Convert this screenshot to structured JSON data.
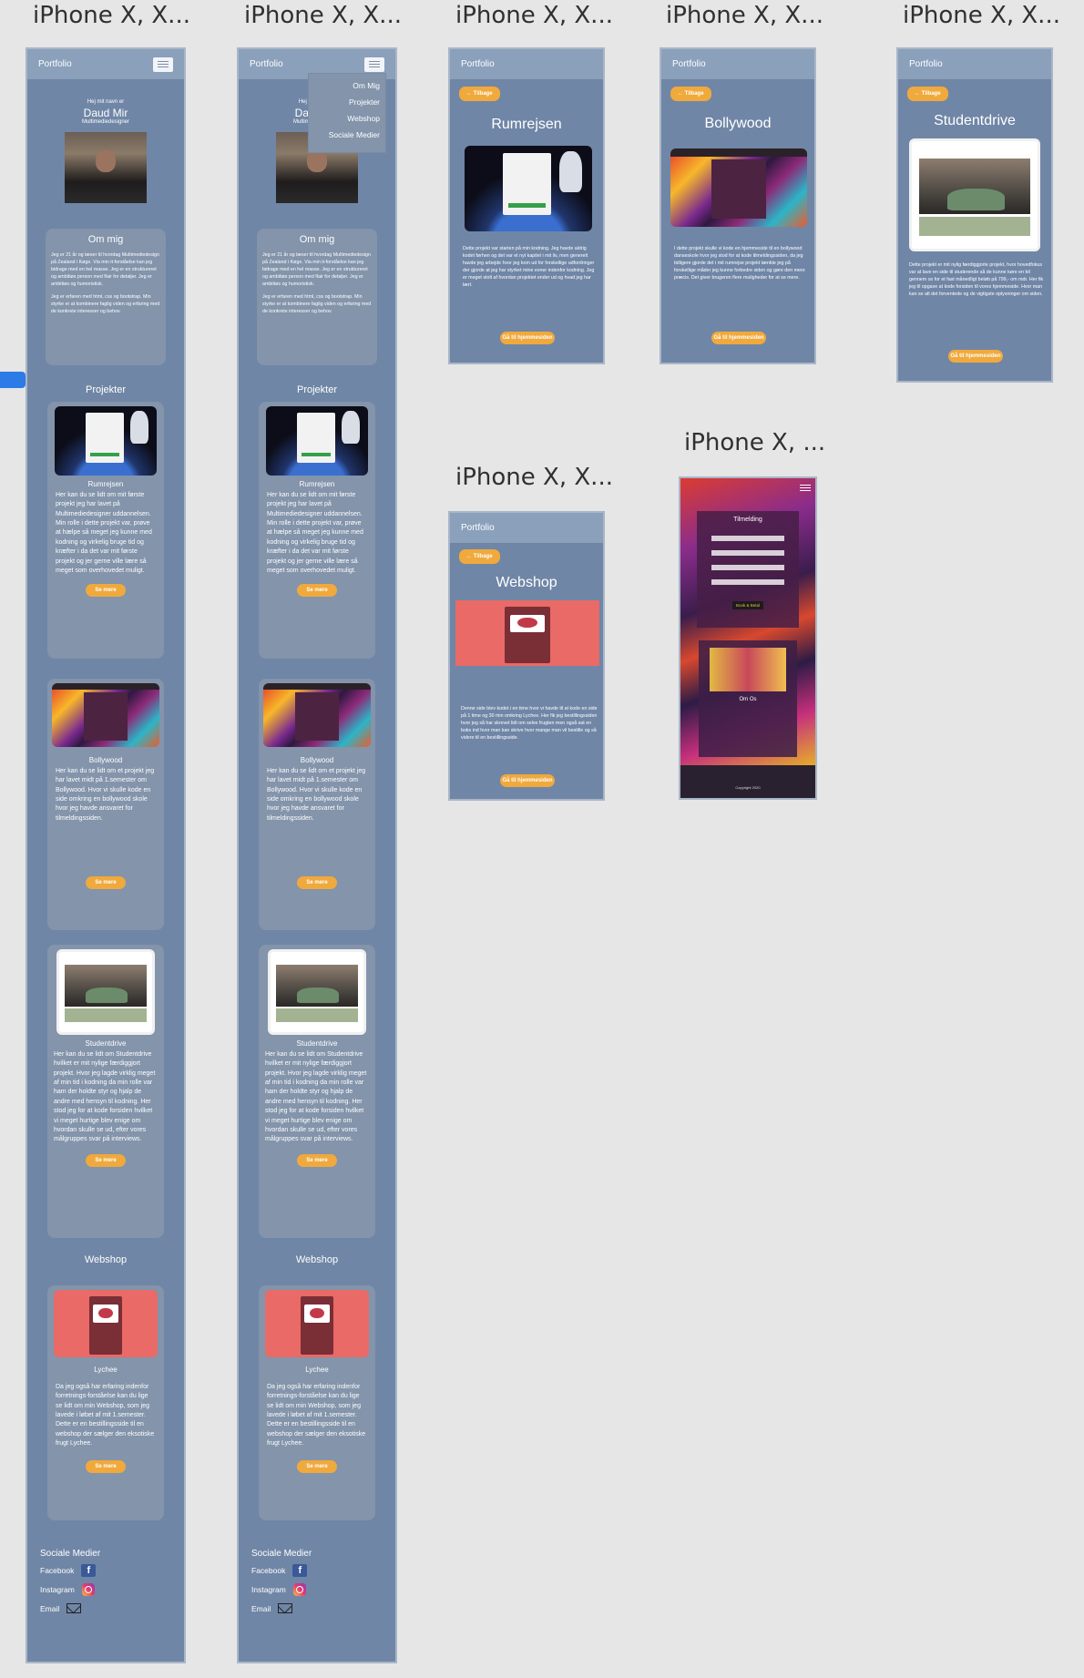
{
  "frame_labels": [
    "iPhone X, X...",
    "iPhone X, X...",
    "iPhone X, X...",
    "iPhone X, X...",
    "iPhone X, X...",
    "iPhone X, X...",
    "iPhone X, ..."
  ],
  "brand": "Portfolio",
  "hero": {
    "greeting": "Hej mit navn er",
    "name": "Daud Mir",
    "role": "Multimediedesigner"
  },
  "about": {
    "title": "Om mig",
    "p1": "Jeg er 21 år og læser til hvordag Multimediedesign på Zealand i Køge. Via min it-forståelse kan jeg bidrage med en hel masse. Jeg er en struktureret og ambitiøs person med flair for detaljer. Jeg er ambitiøs og humoristisk.",
    "p2": "Jeg er erfaren med html, css og bootstrap. Min styrke er at kombinere faglig viden og erfaring med de konkrete interesser og behov."
  },
  "projects": {
    "title": "Projekter",
    "button": "Se mere",
    "rumrejsen": {
      "name": "Rumrejsen",
      "text": "Her kan du se lidt om mit første projekt jeg har lavet på Multimediedesigner uddannelsen. Min rolle i dette projekt var, prøve at hælpe så meget jeg kunne med kodning og virkelig bruge tid og kræfter i da det var mit første projekt og jer gerne ville lære så meget som overhovedet muligt."
    },
    "bollywood": {
      "name": "Bollywood",
      "text": "Her kan du se lidt om et projekt jeg har lavet midt på 1.semester om Bollywood. Hvor vi skulle kode en side omkring en bollywood skole hvor jeg havde ansvaret for tilmeldingssiden."
    },
    "studentdrive": {
      "name": "Studentdrive",
      "text": "Her kan du se lidt om Studentdrive hvilket er mit nylige færdiggjort projekt. Hvor jeg lagde virklig meget af min tid i kodning da min rolle var ham der holdte styr og hjalp de andre med hensyn til kodning. Her stod jeg for at kode forsiden hvilket vi meget hurtige blev enige om hvordan skulle se ud, efter vores målgruppes svar på interviews."
    },
    "webshop": {
      "title": "Webshop",
      "name": "Lychee",
      "text": "Da jeg også har erfaring indenfor forretnings-forståelse kan du lige se lidt om min Webshop, som jeg lavede i løbet af mit 1.semester. Dette er en bestillingsside til en webshop der sælger den eksotiske frugt Lychee."
    }
  },
  "social": {
    "title": "Sociale Medier",
    "facebook": "Facebook",
    "instagram": "Instagram",
    "email": "Email"
  },
  "menu": [
    "Om Mig",
    "Projekter",
    "Webshop",
    "Sociale Medier"
  ],
  "back": "← Tilbage",
  "home_button": "Gå til hjemmesiden",
  "details": {
    "rumrejsen": {
      "title": "Rumrejsen",
      "text": "Dette projekt var starten på min kodning. Jeg havde aldrig kodet førhen og det var et nyt kapitel i mit liv, men generelt havde jeg arbejde hvor jeg kom ud for forskellige udfordringer der gjorde at jeg har styrket mine evner indenfor kodning. Jeg er meget stolt af hvordan projektet ender ud og hvad jeg har lært."
    },
    "bollywood": {
      "title": "Bollywood",
      "text": "I dette projekt skulle vi kode en hjemmeside til en bollywood danseskole hvor jeg stod for at kode tilmeldingssiden, da jeg tidligere gjorde det i mit rumrejse projekt tænkte jeg på forskellige måder jeg kunne forbedre siden og gøre den mere præcis. Det giver brugeren flere muligheder for at se mere."
    },
    "studentdrive": {
      "title": "Studentdrive",
      "text": "Dette projekt er mit nylig færdiggjorte projekt, hvor hovedfokus var at lave en side til studerende så de kunne køre en bil gennem os for et fast månedligt beløb på 799,- om mdr. Her fik jeg til opgave at kode forsiden til vores hjemmeside. Hvor man kan se alt det forventede og de vigtigste oplysninger om siden."
    },
    "webshop": {
      "title": "Webshop",
      "text": "Denne side blev kodet i en time hvor vi havde til at kode en side på 1 time og 30 min omkring Lychee. Her fik jeg bestillingssiden hvor jeg så har skrevet lidt om selve frugten men også sat en boks ind hvor man kan skrive hvor mange man vil bestille og så videre til en bestillingsside."
    }
  },
  "bollywood_page": {
    "form_title": "Tilmelding",
    "submit": "Book & Betal",
    "about": "Om Os",
    "copyright": "Copyright 2020"
  }
}
